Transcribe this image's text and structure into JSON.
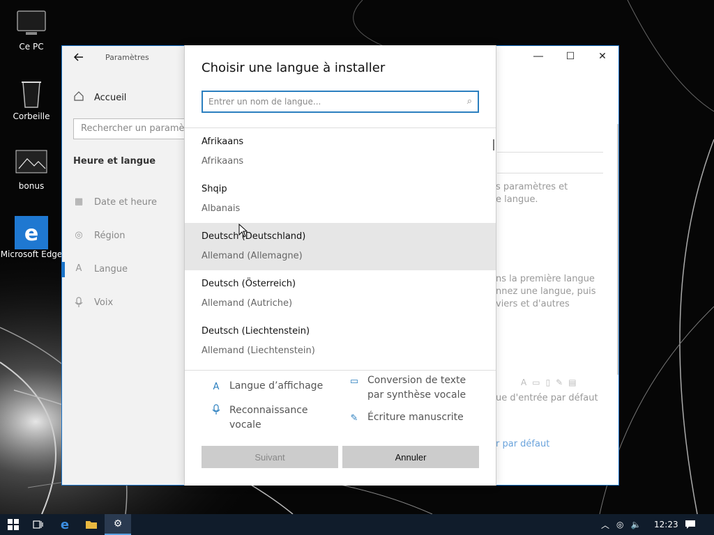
{
  "desktop": {
    "icons": [
      {
        "label": "Ce PC"
      },
      {
        "label": "Corbeille"
      },
      {
        "label": "bonus"
      },
      {
        "label": "Microsoft Edge"
      }
    ]
  },
  "settings": {
    "window_title": "Paramètres",
    "home": "Accueil",
    "search_placeholder": "Rechercher un paramètre",
    "section": "Heure et langue",
    "items": [
      {
        "label": "Date et heure",
        "icon": "calendar-icon"
      },
      {
        "label": "Région",
        "icon": "globe-icon"
      },
      {
        "label": "Langue",
        "icon": "language-icon"
      },
      {
        "label": "Voix",
        "icon": "microphone-icon"
      }
    ],
    "background_texts": {
      "t1a": "s paramètres et",
      "t1b": "e langue.",
      "t2a": "ns la première langue",
      "t2b": "nnez une langue, puis",
      "t2c": "viers et d'autres",
      "t3": "ue d'entrée par défaut",
      "link": "r par défaut"
    }
  },
  "dialog": {
    "title": "Choisir une langue à installer",
    "search_placeholder": "Entrer un nom de langue...",
    "languages": [
      {
        "native": "Afrikaans",
        "french": "Afrikaans"
      },
      {
        "native": "Shqip",
        "french": "Albanais"
      },
      {
        "native": "Deutsch (Deutschland)",
        "french": "Allemand (Allemagne)"
      },
      {
        "native": "Deutsch (Österreich)",
        "french": "Allemand (Autriche)"
      },
      {
        "native": "Deutsch (Liechtenstein)",
        "french": "Allemand (Liechtenstein)"
      }
    ],
    "features": {
      "display": "Langue d’affichage",
      "tts_line1": "Conversion de texte",
      "tts_line2": "par synthèse vocale",
      "speech_line1": "Reconnaissance",
      "speech_line2": "vocale",
      "handwriting": "Écriture manuscrite"
    },
    "next_button": "Suivant",
    "cancel_button": "Annuler"
  },
  "taskbar": {
    "time": "12:23"
  },
  "colors": {
    "accent": "#2b7fbf",
    "taskbar": "#101c2b"
  }
}
